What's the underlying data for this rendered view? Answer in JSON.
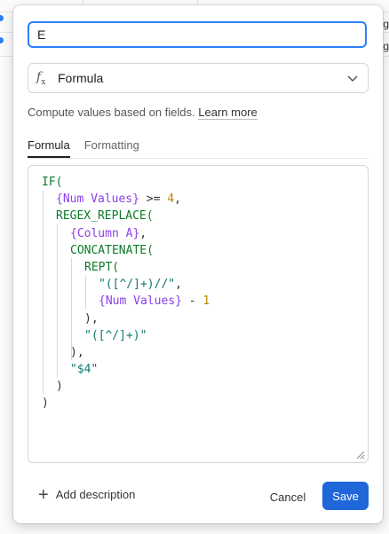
{
  "field_name": {
    "value": "E"
  },
  "field_type": {
    "label": "Formula",
    "icon": "fx-icon"
  },
  "description": {
    "text": "Compute values based on fields.",
    "link": "Learn more"
  },
  "tabs": [
    {
      "label": "Formula",
      "active": true
    },
    {
      "label": "Formatting",
      "active": false
    }
  ],
  "formula": {
    "lines": [
      [
        {
          "t": "IF(",
          "c": "fn"
        }
      ],
      [
        {
          "t": "{Num Values}",
          "c": "field"
        },
        {
          "t": " >= ",
          "c": "op"
        },
        {
          "t": "4",
          "c": "num"
        },
        {
          "t": ",",
          "c": "punc"
        }
      ],
      [
        {
          "t": "REGEX_REPLACE(",
          "c": "fn"
        }
      ],
      [
        {
          "t": "{Column A}",
          "c": "field"
        },
        {
          "t": ",",
          "c": "punc"
        }
      ],
      [
        {
          "t": "CONCATENATE(",
          "c": "fn"
        }
      ],
      [
        {
          "t": "REPT(",
          "c": "fn"
        }
      ],
      [
        {
          "t": "\"([^/]+)//\"",
          "c": "str"
        },
        {
          "t": ",",
          "c": "punc"
        }
      ],
      [
        {
          "t": "{Num Values}",
          "c": "field"
        },
        {
          "t": " - ",
          "c": "op"
        },
        {
          "t": "1",
          "c": "num"
        }
      ],
      [
        {
          "t": "),",
          "c": "punc"
        }
      ],
      [
        {
          "t": "\"([^/]+)\"",
          "c": "str"
        }
      ],
      [
        {
          "t": "),",
          "c": "punc"
        }
      ],
      [
        {
          "t": "\"$4\"",
          "c": "str"
        }
      ],
      [
        {
          "t": ")",
          "c": "punc"
        }
      ],
      [
        {
          "t": ")",
          "c": "punc"
        }
      ]
    ]
  },
  "footer": {
    "add_description": "Add description",
    "cancel": "Cancel",
    "save": "Save"
  },
  "colors": {
    "accent": "#1f67d9",
    "focus": "#2d7ff9",
    "function": "#0d7a28",
    "field": "#8a3ee8",
    "number": "#b8860b",
    "string": "#0d7a70"
  }
}
